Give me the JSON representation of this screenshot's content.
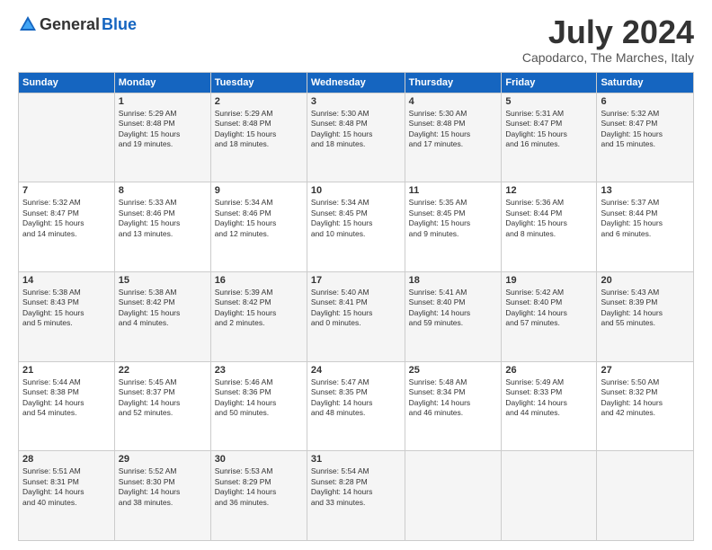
{
  "logo": {
    "general": "General",
    "blue": "Blue"
  },
  "title": "July 2024",
  "location": "Capodarco, The Marches, Italy",
  "days": [
    "Sunday",
    "Monday",
    "Tuesday",
    "Wednesday",
    "Thursday",
    "Friday",
    "Saturday"
  ],
  "weeks": [
    [
      {
        "day": "",
        "info": ""
      },
      {
        "day": "1",
        "info": "Sunrise: 5:29 AM\nSunset: 8:48 PM\nDaylight: 15 hours\nand 19 minutes."
      },
      {
        "day": "2",
        "info": "Sunrise: 5:29 AM\nSunset: 8:48 PM\nDaylight: 15 hours\nand 18 minutes."
      },
      {
        "day": "3",
        "info": "Sunrise: 5:30 AM\nSunset: 8:48 PM\nDaylight: 15 hours\nand 18 minutes."
      },
      {
        "day": "4",
        "info": "Sunrise: 5:30 AM\nSunset: 8:48 PM\nDaylight: 15 hours\nand 17 minutes."
      },
      {
        "day": "5",
        "info": "Sunrise: 5:31 AM\nSunset: 8:47 PM\nDaylight: 15 hours\nand 16 minutes."
      },
      {
        "day": "6",
        "info": "Sunrise: 5:32 AM\nSunset: 8:47 PM\nDaylight: 15 hours\nand 15 minutes."
      }
    ],
    [
      {
        "day": "7",
        "info": "Sunrise: 5:32 AM\nSunset: 8:47 PM\nDaylight: 15 hours\nand 14 minutes."
      },
      {
        "day": "8",
        "info": "Sunrise: 5:33 AM\nSunset: 8:46 PM\nDaylight: 15 hours\nand 13 minutes."
      },
      {
        "day": "9",
        "info": "Sunrise: 5:34 AM\nSunset: 8:46 PM\nDaylight: 15 hours\nand 12 minutes."
      },
      {
        "day": "10",
        "info": "Sunrise: 5:34 AM\nSunset: 8:45 PM\nDaylight: 15 hours\nand 10 minutes."
      },
      {
        "day": "11",
        "info": "Sunrise: 5:35 AM\nSunset: 8:45 PM\nDaylight: 15 hours\nand 9 minutes."
      },
      {
        "day": "12",
        "info": "Sunrise: 5:36 AM\nSunset: 8:44 PM\nDaylight: 15 hours\nand 8 minutes."
      },
      {
        "day": "13",
        "info": "Sunrise: 5:37 AM\nSunset: 8:44 PM\nDaylight: 15 hours\nand 6 minutes."
      }
    ],
    [
      {
        "day": "14",
        "info": "Sunrise: 5:38 AM\nSunset: 8:43 PM\nDaylight: 15 hours\nand 5 minutes."
      },
      {
        "day": "15",
        "info": "Sunrise: 5:38 AM\nSunset: 8:42 PM\nDaylight: 15 hours\nand 4 minutes."
      },
      {
        "day": "16",
        "info": "Sunrise: 5:39 AM\nSunset: 8:42 PM\nDaylight: 15 hours\nand 2 minutes."
      },
      {
        "day": "17",
        "info": "Sunrise: 5:40 AM\nSunset: 8:41 PM\nDaylight: 15 hours\nand 0 minutes."
      },
      {
        "day": "18",
        "info": "Sunrise: 5:41 AM\nSunset: 8:40 PM\nDaylight: 14 hours\nand 59 minutes."
      },
      {
        "day": "19",
        "info": "Sunrise: 5:42 AM\nSunset: 8:40 PM\nDaylight: 14 hours\nand 57 minutes."
      },
      {
        "day": "20",
        "info": "Sunrise: 5:43 AM\nSunset: 8:39 PM\nDaylight: 14 hours\nand 55 minutes."
      }
    ],
    [
      {
        "day": "21",
        "info": "Sunrise: 5:44 AM\nSunset: 8:38 PM\nDaylight: 14 hours\nand 54 minutes."
      },
      {
        "day": "22",
        "info": "Sunrise: 5:45 AM\nSunset: 8:37 PM\nDaylight: 14 hours\nand 52 minutes."
      },
      {
        "day": "23",
        "info": "Sunrise: 5:46 AM\nSunset: 8:36 PM\nDaylight: 14 hours\nand 50 minutes."
      },
      {
        "day": "24",
        "info": "Sunrise: 5:47 AM\nSunset: 8:35 PM\nDaylight: 14 hours\nand 48 minutes."
      },
      {
        "day": "25",
        "info": "Sunrise: 5:48 AM\nSunset: 8:34 PM\nDaylight: 14 hours\nand 46 minutes."
      },
      {
        "day": "26",
        "info": "Sunrise: 5:49 AM\nSunset: 8:33 PM\nDaylight: 14 hours\nand 44 minutes."
      },
      {
        "day": "27",
        "info": "Sunrise: 5:50 AM\nSunset: 8:32 PM\nDaylight: 14 hours\nand 42 minutes."
      }
    ],
    [
      {
        "day": "28",
        "info": "Sunrise: 5:51 AM\nSunset: 8:31 PM\nDaylight: 14 hours\nand 40 minutes."
      },
      {
        "day": "29",
        "info": "Sunrise: 5:52 AM\nSunset: 8:30 PM\nDaylight: 14 hours\nand 38 minutes."
      },
      {
        "day": "30",
        "info": "Sunrise: 5:53 AM\nSunset: 8:29 PM\nDaylight: 14 hours\nand 36 minutes."
      },
      {
        "day": "31",
        "info": "Sunrise: 5:54 AM\nSunset: 8:28 PM\nDaylight: 14 hours\nand 33 minutes."
      },
      {
        "day": "",
        "info": ""
      },
      {
        "day": "",
        "info": ""
      },
      {
        "day": "",
        "info": ""
      }
    ]
  ]
}
